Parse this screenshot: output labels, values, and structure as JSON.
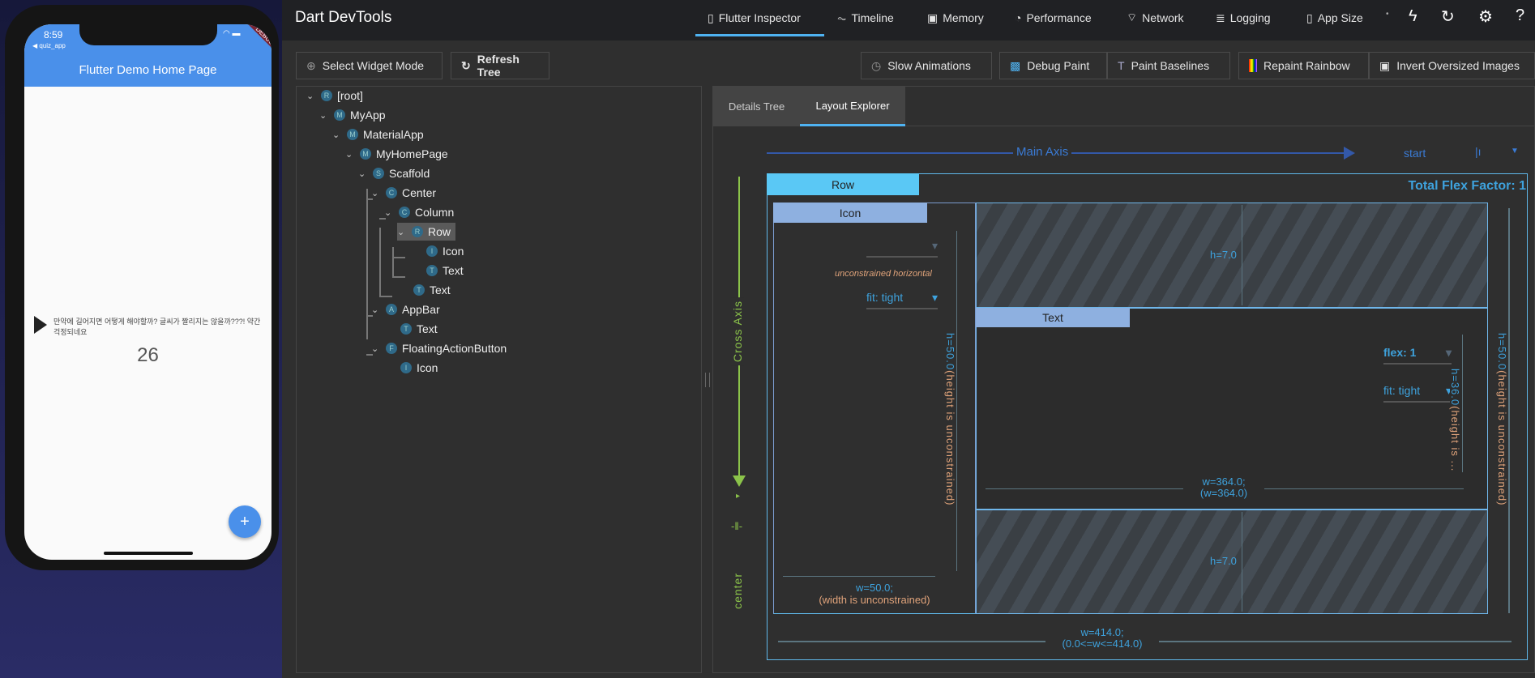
{
  "phone": {
    "time": "8:59",
    "back_app": "◀ quiz_app",
    "debug_banner": "DEBUG",
    "appbar_title": "Flutter Demo Home Page",
    "row_text": "만약에 길어지면 어떻게 해야할까? 글씨가 짤리지는 않을까???! 약간 걱정되네요",
    "counter": "26",
    "fab_label": "+"
  },
  "header": {
    "title": "Dart DevTools",
    "tabs": [
      {
        "label": "Flutter Inspector",
        "icon": "phone-icon"
      },
      {
        "label": "Timeline",
        "icon": "timeline-icon"
      },
      {
        "label": "Memory",
        "icon": "memory-icon"
      },
      {
        "label": "Performance",
        "icon": "performance-icon"
      },
      {
        "label": "Network",
        "icon": "network-icon"
      },
      {
        "label": "Logging",
        "icon": "logging-icon"
      },
      {
        "label": "App Size",
        "icon": "app-size-icon"
      }
    ]
  },
  "toolbar": {
    "select_widget_mode": "Select Widget Mode",
    "refresh_tree": "Refresh Tree",
    "slow_animations": "Slow Animations",
    "debug_paint": "Debug Paint",
    "paint_baselines": "Paint Baselines",
    "repaint_rainbow": "Repaint Rainbow",
    "invert_oversized": "Invert Oversized Images"
  },
  "tree": [
    {
      "label": "[root]",
      "badge": "R"
    },
    {
      "label": "MyApp",
      "badge": "M"
    },
    {
      "label": "MaterialApp",
      "badge": "M"
    },
    {
      "label": "MyHomePage",
      "badge": "M"
    },
    {
      "label": "Scaffold",
      "badge": "S"
    },
    {
      "label": "Center",
      "badge": "C"
    },
    {
      "label": "Column",
      "badge": "C"
    },
    {
      "label": "Row",
      "badge": "R"
    },
    {
      "label": "Icon",
      "badge": "I"
    },
    {
      "label": "Text",
      "badge": "T"
    },
    {
      "label": "Text",
      "badge": "T"
    },
    {
      "label": "AppBar",
      "badge": "A"
    },
    {
      "label": "Text",
      "badge": "T"
    },
    {
      "label": "FloatingActionButton",
      "badge": "F"
    },
    {
      "label": "Icon",
      "badge": "I"
    }
  ],
  "details_tabs": {
    "details_tree": "Details Tree",
    "layout_explorer": "Layout Explorer"
  },
  "layout": {
    "main_axis": "Main Axis",
    "main_alignment": "start",
    "cross_axis": "Cross Axis",
    "cross_alignment": "center",
    "row_label": "Row",
    "total_flex": "Total Flex Factor: 1",
    "icon_label": "Icon",
    "unconstrained_horizontal": "unconstrained horizontal",
    "icon_fit": "fit: tight",
    "icon_height": "h=50.0",
    "icon_height_note": "(height is unconstrained)",
    "icon_width": "w=50.0;",
    "icon_width_note": "(width is unconstrained)",
    "text_label": "Text",
    "text_flex": "flex: 1",
    "text_fit": "fit: tight",
    "text_height": "h=36.0",
    "text_height_note": "(height is ...",
    "text_width": "w=364.0;",
    "text_width_note": "(w=364.0)",
    "space_top": "h=7.0",
    "space_bottom": "h=7.0",
    "row_height": "h=50.0",
    "row_height_note": "(height is unconstrained)",
    "row_width": "w=414.0;",
    "row_width_note": "(0.0<=w<=414.0)"
  }
}
